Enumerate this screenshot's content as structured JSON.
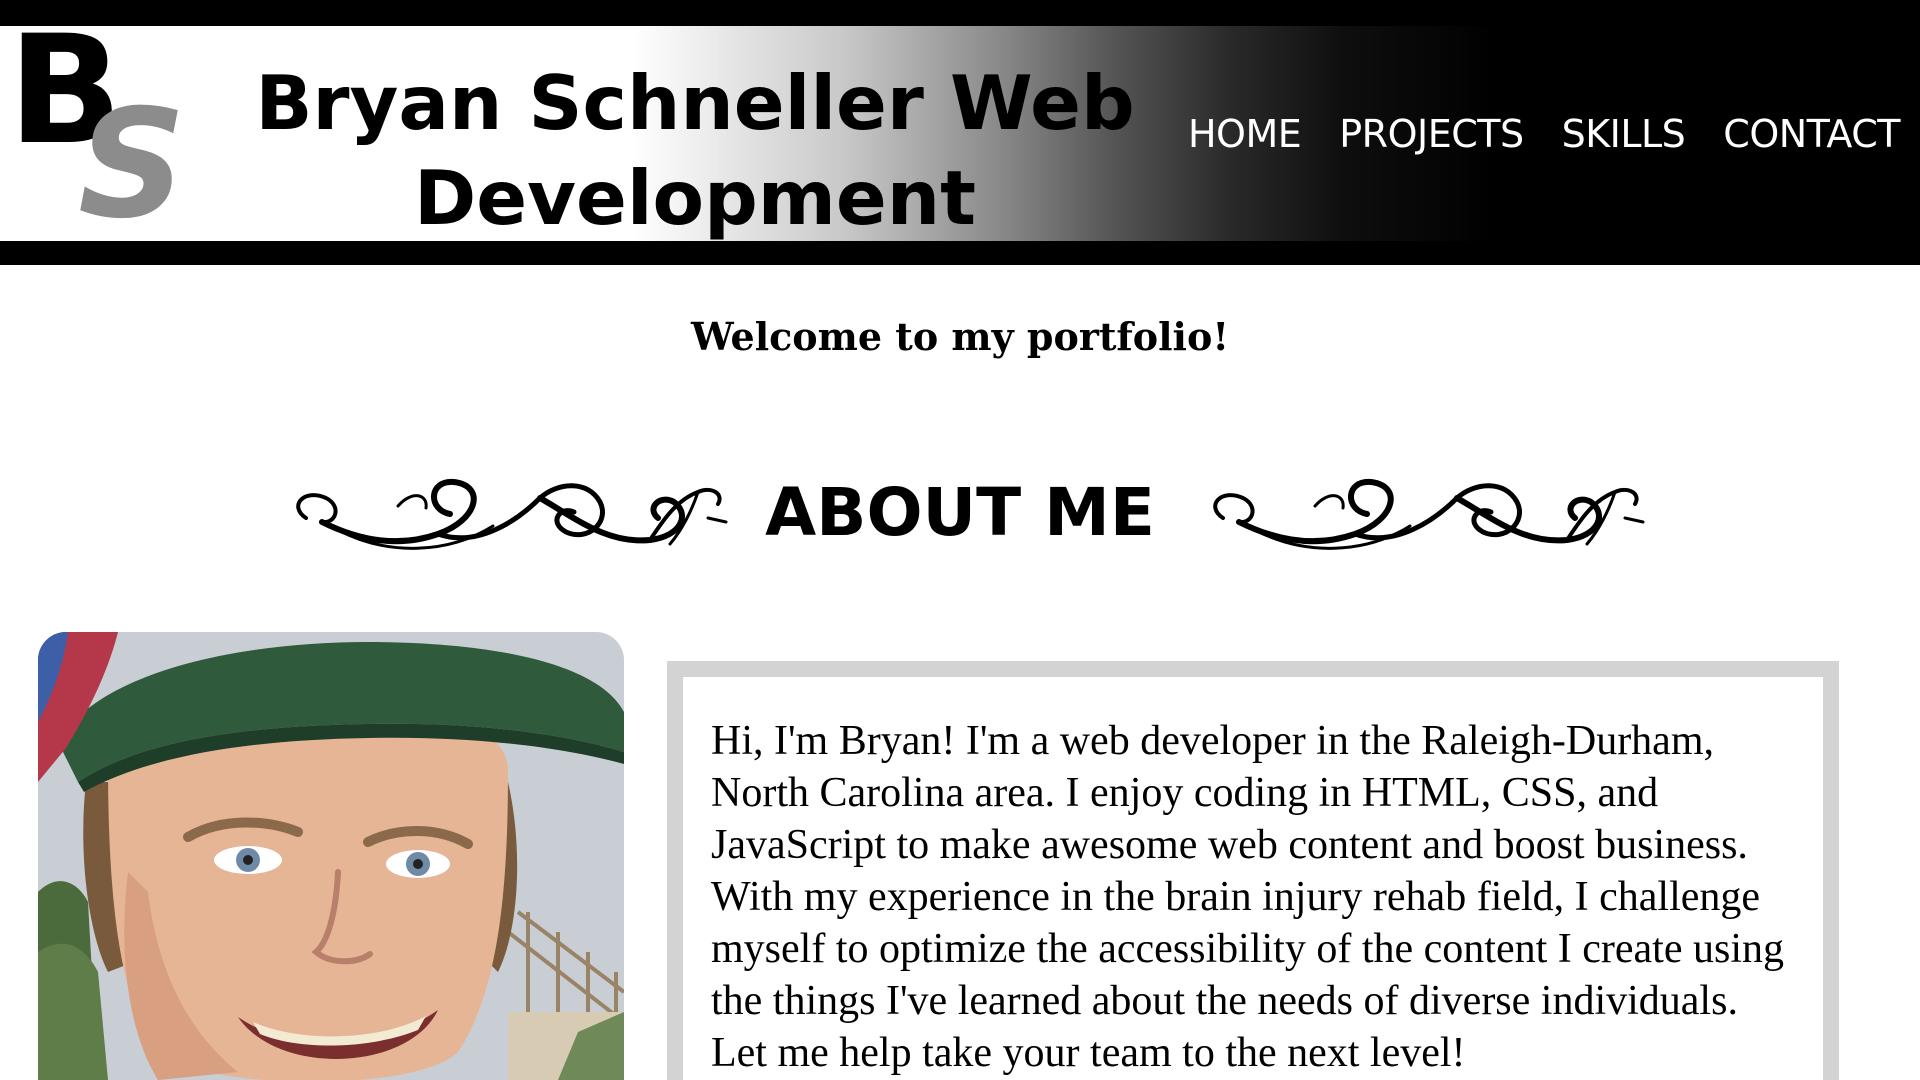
{
  "header": {
    "logo_letters": [
      "B",
      "S"
    ],
    "site_title": "Bryan Schneller Web Development",
    "nav": [
      {
        "label": "HOME"
      },
      {
        "label": "PROJECTS"
      },
      {
        "label": "SKILLS"
      },
      {
        "label": "CONTACT"
      }
    ]
  },
  "main": {
    "welcome": "Welcome to my portfolio!",
    "about_heading": "ABOUT ME",
    "about_text": "Hi, I'm Bryan! I'm a web developer in the Raleigh-Durham, North Carolina area. I enjoy coding in HTML, CSS, and JavaScript to make awesome web content and boost business. With my experience in the brain injury rehab field, I challenge myself to optimize the accessibility of the content I create using the things I've learned about the needs of diverse individuals. Let me help take your team to the next level!"
  },
  "colors": {
    "header_background": "#000000",
    "logo_s": "#8c8c8c",
    "nav_text": "#ffffff",
    "about_box_border": "#d3d3d3"
  },
  "icons": {
    "flourish": "ornamental-scroll-icon"
  }
}
